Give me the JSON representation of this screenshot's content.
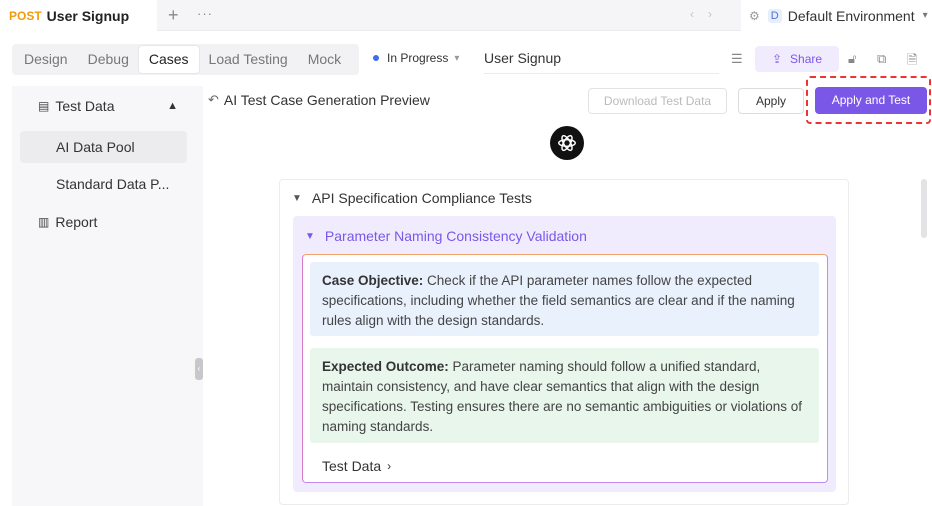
{
  "top_tab": {
    "method": "POST",
    "title": "User Signup"
  },
  "environment": {
    "badge": "D",
    "name": "Default Environment"
  },
  "view_tabs": [
    {
      "label": "Design",
      "active": false
    },
    {
      "label": "Debug",
      "active": false
    },
    {
      "label": "Cases",
      "active": true
    },
    {
      "label": "Load Testing",
      "active": false
    },
    {
      "label": "Mock",
      "active": false
    }
  ],
  "status": {
    "label": "In Progress",
    "color": "#3f6df0"
  },
  "name_field": {
    "value": "User Signup"
  },
  "share_label": "Share",
  "sidebar": {
    "group_label": "Test Data",
    "items": [
      {
        "label": "AI Data Pool",
        "active": true
      },
      {
        "label": "Standard Data P...",
        "active": false
      }
    ],
    "report_label": "Report"
  },
  "main": {
    "title": "AI Test Case Generation Preview",
    "download_label": "Download Test Data",
    "apply_label": "Apply",
    "apply_test_label": "Apply and Test",
    "accent_color": "#7b57e8"
  },
  "suite": {
    "title": "API Specification Compliance Tests",
    "case": {
      "title": "Parameter Naming Consistency Validation",
      "objective_label": "Case Objective:",
      "objective_text": " Check if the API parameter names follow the expected specifications, including whether the field semantics are clear and if the naming rules align with the design standards.",
      "outcome_label": "Expected Outcome:",
      "outcome_text": " Parameter naming should follow a unified standard, maintain consistency, and have clear semantics that align with the design specifications. Testing ensures there are no semantic ambiguities or violations of naming standards.",
      "test_data_label": "Test Data"
    }
  }
}
